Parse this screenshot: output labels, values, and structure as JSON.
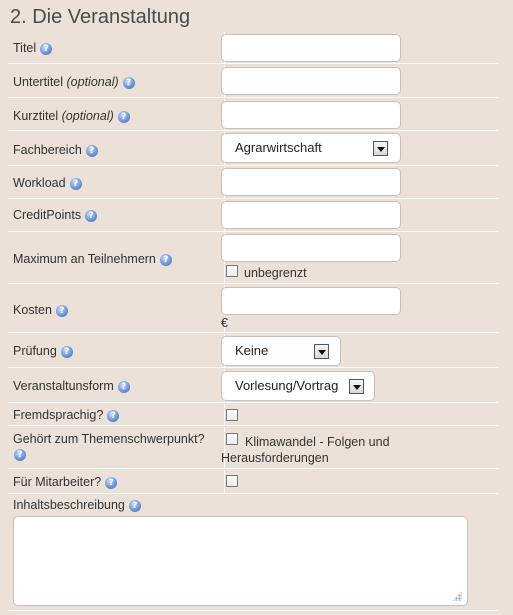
{
  "section_title": "2. Die Veranstaltung",
  "fields": {
    "titel": {
      "label": "Titel",
      "value": ""
    },
    "untertitel": {
      "label": "Untertitel",
      "optional": "(optional)",
      "value": ""
    },
    "kurztitel": {
      "label": "Kurztitel",
      "optional": "(optional)",
      "value": ""
    },
    "fachbereich": {
      "label": "Fachbereich",
      "selected": "Agrarwirtschaft"
    },
    "workload": {
      "label": "Workload",
      "value": ""
    },
    "creditpoints": {
      "label": "CreditPoints",
      "value": ""
    },
    "max_teilnehmer": {
      "label": "Maximum an Teilnehmern",
      "value": "",
      "checkbox_label": "unbegrenzt",
      "checked": false
    },
    "kosten": {
      "label": "Kosten",
      "value": "",
      "currency": "€"
    },
    "pruefung": {
      "label": "Prüfung",
      "selected": "Keine"
    },
    "veranstaltungsform": {
      "label": "Veranstaltunsform",
      "selected": "Vorlesung/Vortrag"
    },
    "fremdsprachig": {
      "label": "Fremdsprachig?",
      "checked": false
    },
    "themenschwerpunkt": {
      "label": "Gehört zum Themenschwerpunkt?",
      "checkbox_label_line1": "Klimawandel - Folgen und",
      "checkbox_label_line2": "Herausforderungen",
      "checked": false
    },
    "mitarbeiter": {
      "label": "Für Mitarbeiter?",
      "checked": false
    },
    "inhaltsbeschreibung": {
      "label": "Inhaltsbeschreibung",
      "value": ""
    }
  },
  "icons": {
    "help": "help-icon",
    "help_glyph": "?"
  }
}
